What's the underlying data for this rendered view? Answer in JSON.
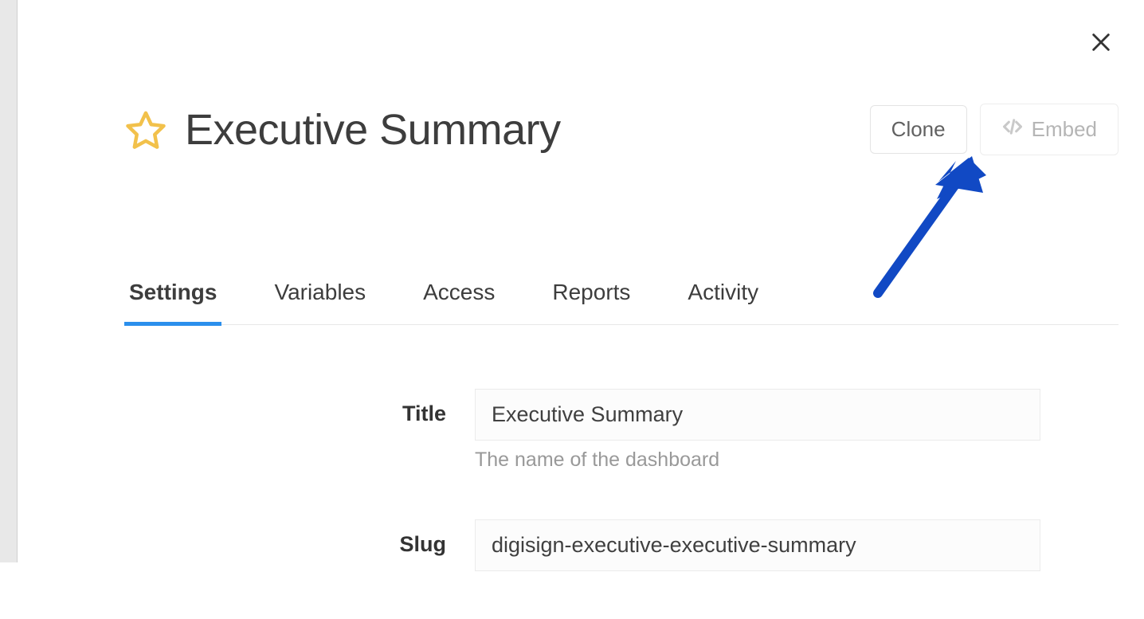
{
  "header": {
    "title": "Executive Summary",
    "buttons": {
      "clone": "Clone",
      "embed": "Embed"
    }
  },
  "tabs": [
    {
      "label": "Settings",
      "active": true
    },
    {
      "label": "Variables",
      "active": false
    },
    {
      "label": "Access",
      "active": false
    },
    {
      "label": "Reports",
      "active": false
    },
    {
      "label": "Activity",
      "active": false
    }
  ],
  "form": {
    "title": {
      "label": "Title",
      "value": "Executive Summary",
      "help": "The name of the dashboard"
    },
    "slug": {
      "label": "Slug",
      "value": "digisign-executive-executive-summary"
    }
  }
}
